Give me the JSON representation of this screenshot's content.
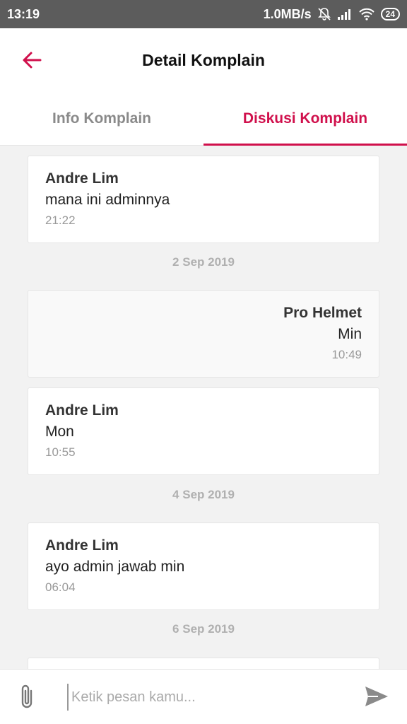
{
  "status_bar": {
    "time": "13:19",
    "network_speed": "1.0MB/s",
    "battery": "24",
    "icons": [
      "bell-off-icon",
      "signal-icon",
      "wifi-icon",
      "battery-icon"
    ]
  },
  "header": {
    "title": "Detail Komplain",
    "back_icon": "arrow-left-icon"
  },
  "tabs": [
    {
      "label": "Info Komplain",
      "active": false
    },
    {
      "label": "Diskusi Komplain",
      "active": true
    }
  ],
  "messages": [
    {
      "sender": "Andre Lim",
      "text": "mana ini adminnya",
      "time": "21:22",
      "mine": false
    },
    {
      "date": "2 Sep 2019"
    },
    {
      "sender": "Pro Helmet",
      "text": "Min",
      "time": "10:49",
      "mine": true
    },
    {
      "sender": "Andre Lim",
      "text": "Mon",
      "time": "10:55",
      "mine": false
    },
    {
      "date": "4 Sep 2019"
    },
    {
      "sender": "Andre Lim",
      "text": "ayo admin jawab min",
      "time": "06:04",
      "mine": false
    },
    {
      "date": "6 Sep 2019"
    }
  ],
  "composer": {
    "placeholder": "Ketik pesan kamu...",
    "value": "",
    "attach_icon": "paperclip-icon",
    "send_icon": "send-icon"
  },
  "colors": {
    "accent": "#d0104c",
    "status_bar": "#5c5c5c"
  }
}
